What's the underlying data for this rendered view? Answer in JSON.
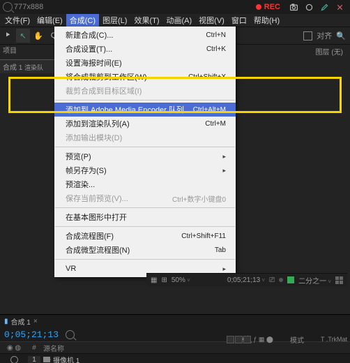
{
  "titlebar": {
    "zoom": "777x888",
    "rec": "REC"
  },
  "menus": [
    "文件(F)",
    "编辑(E)",
    "合成(C)",
    "图层(L)",
    "效果(T)",
    "动画(A)",
    "视图(V)",
    "窗口",
    "帮助(H)"
  ],
  "toolrow": {
    "align": "对齐"
  },
  "project": {
    "label": "项目",
    "comp_tab": "合成 1",
    "sub": "渲染队"
  },
  "rightpanel": {
    "layer": "图层 (无)"
  },
  "dropdown": {
    "g1": [
      {
        "label": "新建合成(C)...",
        "shortcut": "Ctrl+N"
      },
      {
        "label": "合成设置(T)...",
        "shortcut": "Ctrl+K"
      },
      {
        "label": "设置海报时间(E)",
        "shortcut": ""
      },
      {
        "label": "将合成裁剪到工作区(W)",
        "shortcut": "Ctrl+Shift+X"
      },
      {
        "label": "裁剪合成到目标区域(I)",
        "shortcut": "",
        "dis": true
      }
    ],
    "g2": [
      {
        "label": "添加到 Adobe Media Encoder 队列...",
        "shortcut": "Ctrl+Alt+M",
        "hi": true
      },
      {
        "label": "添加到渲染队列(A)",
        "shortcut": "Ctrl+M"
      },
      {
        "label": "添加输出模块(D)",
        "shortcut": "",
        "dis": true
      }
    ],
    "g3": [
      {
        "label": "预览(P)",
        "sub": true
      },
      {
        "label": "帧另存为(S)",
        "sub": true
      },
      {
        "label": "预渲染...",
        "shortcut": ""
      },
      {
        "label": "保存当前预览(V)...",
        "shortcut": "Ctrl+数字小键盘0",
        "dis": true
      }
    ],
    "g4": [
      {
        "label": "在基本图形中打开",
        "shortcut": ""
      }
    ],
    "g5": [
      {
        "label": "合成流程图(F)",
        "shortcut": "Ctrl+Shift+F11"
      },
      {
        "label": "合成微型流程图(N)",
        "shortcut": "Tab"
      }
    ],
    "g6": [
      {
        "label": "VR",
        "sub": true
      }
    ]
  },
  "viewer": {
    "zoom": "50%",
    "tc": "0;05;21;13",
    "cam": "二分之一"
  },
  "timeline": {
    "tab": "合成 1",
    "timecode": "0;05;21;13",
    "hdr_num": "#",
    "hdr_src": "源名称",
    "hdr_mode": "模式",
    "hdr_trk": "T .TrkMat",
    "row_num": "1",
    "row_name": "摄像机 1"
  }
}
